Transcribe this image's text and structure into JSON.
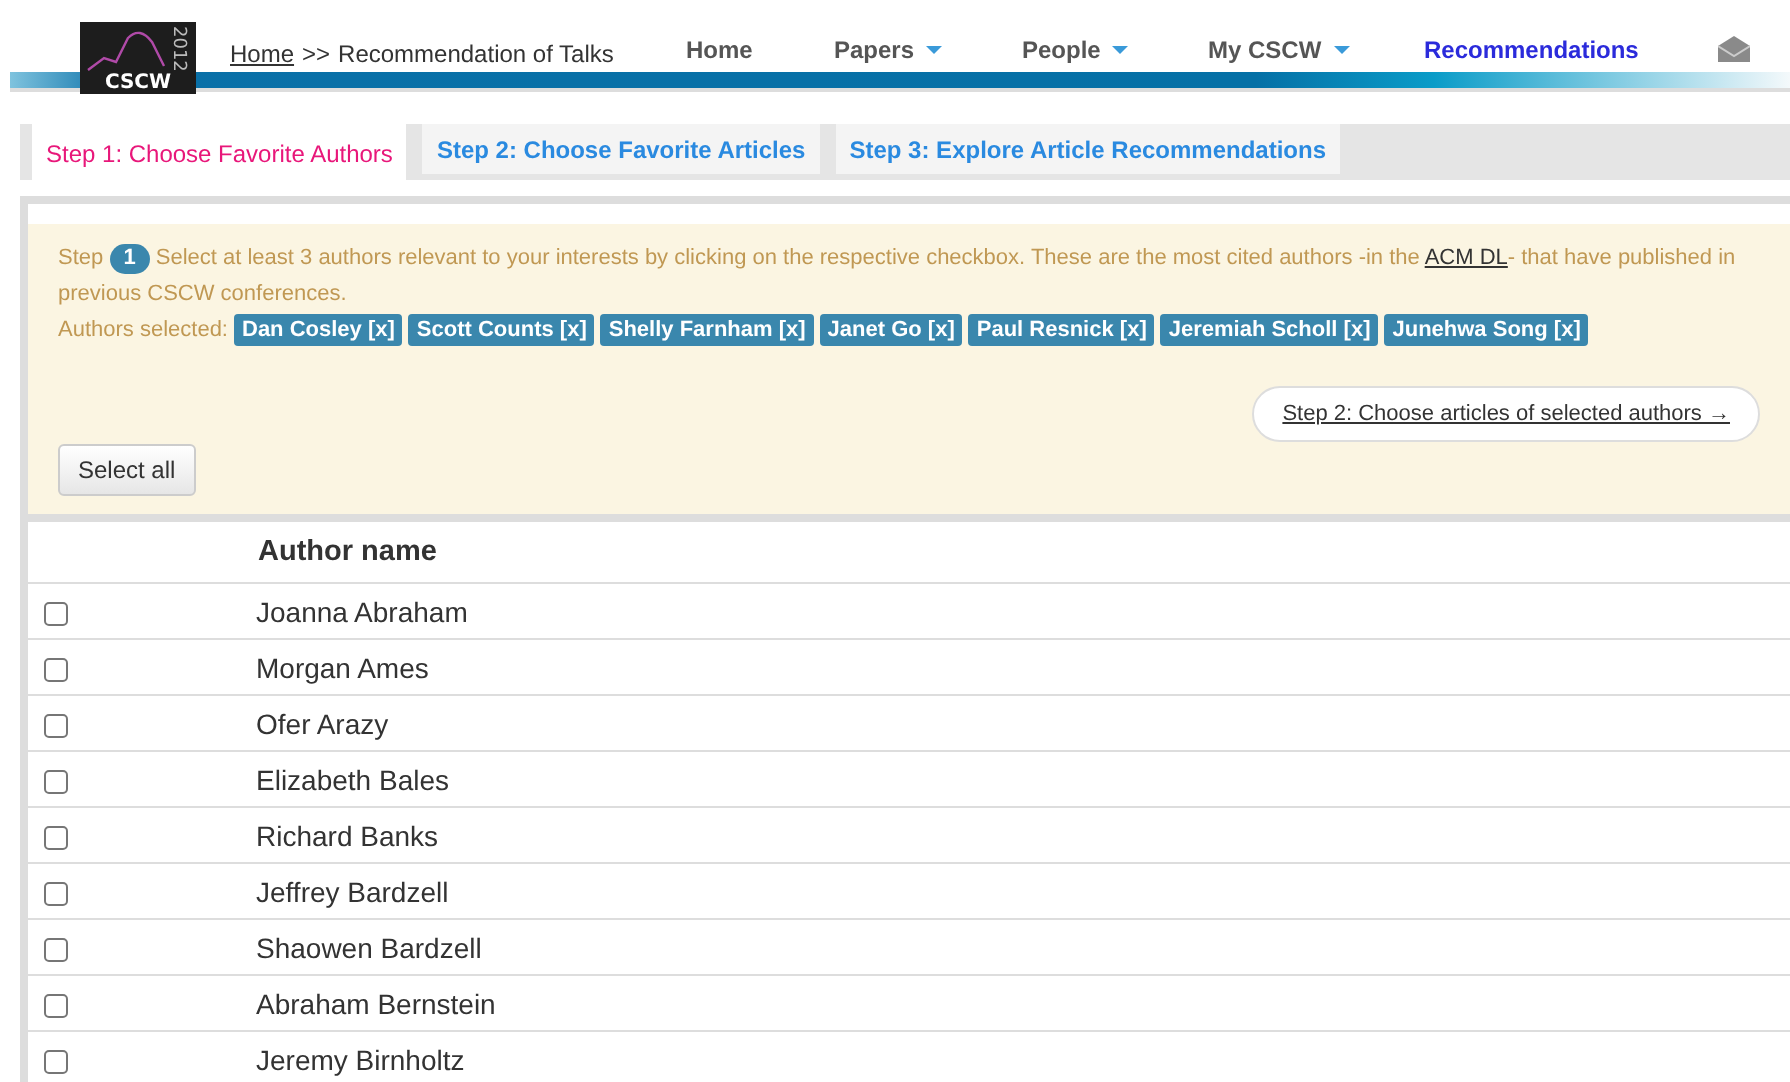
{
  "logo": {
    "text": "CSCW",
    "year": "2012"
  },
  "breadcrumb": {
    "link": "Home",
    "separator": ">>",
    "current": "Recommendation of Talks"
  },
  "nav": [
    {
      "label": "Home",
      "dropdown": false,
      "selected": false
    },
    {
      "label": "Papers",
      "dropdown": true,
      "selected": false
    },
    {
      "label": "People",
      "dropdown": true,
      "selected": false
    },
    {
      "label": "My CSCW",
      "dropdown": true,
      "selected": false
    },
    {
      "label": "Recommendations",
      "dropdown": false,
      "selected": true
    }
  ],
  "tabs": [
    {
      "label": "Step 1: Choose Favorite Authors",
      "selected": true
    },
    {
      "label": "Step 2: Choose Favorite Articles",
      "selected": false
    },
    {
      "label": "Step 3: Explore Article Recommendations",
      "selected": false
    }
  ],
  "intro": {
    "step_word": "Step",
    "step_number": "1",
    "text_before_link": "Select at least 3 authors relevant to your interests by clicking on the respective checkbox. These are the most cited authors -in the",
    "link": "ACM DL",
    "text_after_link": "- that have published in previous CSCW conferences."
  },
  "selected_authors": {
    "label": "Authors selected:",
    "tags": [
      "Dan Cosley [x]",
      "Scott Counts [x]",
      "Shelly Farnham [x]",
      "Janet Go [x]",
      "Paul Resnick [x]",
      "Jeremiah Scholl [x]",
      "Junehwa Song [x]"
    ]
  },
  "next_step_link": "Step 2: Choose articles of selected authors →",
  "select_all_button": "Select all",
  "table": {
    "columns": [
      "Author name"
    ],
    "rows": [
      {
        "name": "Joanna Abraham",
        "checked": false
      },
      {
        "name": "Morgan Ames",
        "checked": false
      },
      {
        "name": "Ofer Arazy",
        "checked": false
      },
      {
        "name": "Elizabeth Bales",
        "checked": false
      },
      {
        "name": "Richard Banks",
        "checked": false
      },
      {
        "name": "Jeffrey Bardzell",
        "checked": false
      },
      {
        "name": "Shaowen Bardzell",
        "checked": false
      },
      {
        "name": "Abraham Bernstein",
        "checked": false
      },
      {
        "name": "Jeremy Birnholtz",
        "checked": false
      }
    ]
  }
}
